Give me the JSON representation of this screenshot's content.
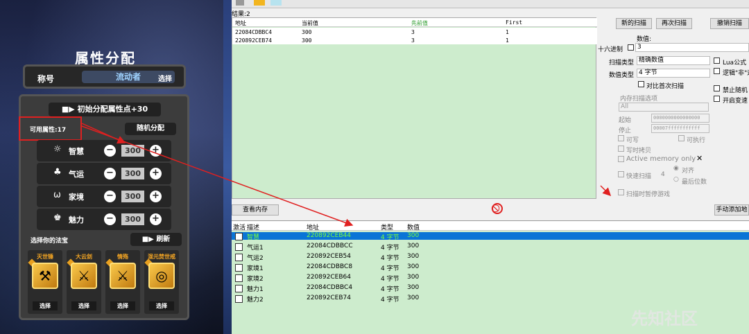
{
  "game": {
    "title": "属性分配",
    "name_label": "称号",
    "name_value": "流动者",
    "name_select": "选择",
    "init_button": "初始分配属性点+30",
    "available": "可用属性:17",
    "random_button": "随机分配",
    "attributes": [
      {
        "icon": "☼",
        "name": "智慧",
        "value": "300"
      },
      {
        "icon": "♣",
        "name": "气运",
        "value": "300"
      },
      {
        "icon": "ω",
        "name": "家境",
        "value": "300"
      },
      {
        "icon": "♚",
        "name": "魅力",
        "value": "300"
      }
    ],
    "treasure_label": "选择你的法宝",
    "refresh_button": "刷新",
    "treasures": [
      {
        "name": "灭世锤",
        "icon": "⚒",
        "pick": "选择"
      },
      {
        "name": "大云剑",
        "icon": "⚔",
        "pick": "选择"
      },
      {
        "name": "情殇",
        "icon": "⚔",
        "pick": "选择"
      },
      {
        "name": "混元焚世戒",
        "icon": "◎",
        "pick": "选择"
      }
    ]
  },
  "ce": {
    "results_label": "结果:2",
    "scan_headers": {
      "addr": "地址",
      "current": "当前值",
      "previous": "先前值",
      "first": "First"
    },
    "scan_rows": [
      {
        "addr": "22084CDBBC4",
        "current": "300",
        "previous": "3",
        "first": "1"
      },
      {
        "addr": "220892CEB74",
        "current": "300",
        "previous": "3",
        "first": "1"
      }
    ],
    "new_scan": "新的扫描",
    "next_scan": "再次扫描",
    "undo_scan": "撤销扫描",
    "value_label": "数值:",
    "hex_label": "十六进制",
    "value_input": "3",
    "scan_type_label": "扫描类型",
    "scan_type_value": "精确数值",
    "value_type_label": "数值类型",
    "value_type_value": "4 字节",
    "compare_first": "对比首次扫描",
    "lua_formula": "Lua公式",
    "logic_not": "逻辑\"非\"运",
    "disable_random": "禁止随机",
    "enable_speed": "开启变速",
    "mem_options": "内存扫描选项",
    "mem_all": "All",
    "start_label": "起始",
    "start_value": "0000000000000000",
    "stop_label": "停止",
    "stop_value": "00007fffffffffff",
    "writable": "可写",
    "executable": "可执行",
    "copy_on_write": "写时拷贝",
    "active_memory": "Active memory only",
    "fast_scan": "快速扫描",
    "fast_value": "4",
    "align": "对齐",
    "last_digits": "最后位数",
    "pause_game": "扫描时暂停游戏",
    "view_memory": "查看内存",
    "manual_add": "手动添加地",
    "addr_headers": {
      "active": "激活",
      "desc": "描述",
      "addr": "地址",
      "type": "类型",
      "value": "数值"
    },
    "addr_rows": [
      {
        "desc": "智慧",
        "addr": "220892CEB44",
        "type": "4 字节",
        "value": "300"
      },
      {
        "desc": "气运1",
        "addr": "22084CDBBCC",
        "type": "4 字节",
        "value": "300"
      },
      {
        "desc": "气运2",
        "addr": "220892CEB54",
        "type": "4 字节",
        "value": "300"
      },
      {
        "desc": "家境1",
        "addr": "22084CDBBC8",
        "type": "4 字节",
        "value": "300"
      },
      {
        "desc": "家境2",
        "addr": "220892CEB64",
        "type": "4 字节",
        "value": "300"
      },
      {
        "desc": "魅力1",
        "addr": "22084CDBBC4",
        "type": "4 字节",
        "value": "300"
      },
      {
        "desc": "魅力2",
        "addr": "220892CEB74",
        "type": "4 字节",
        "value": "300"
      }
    ],
    "watermark": "先知社区"
  },
  "colors": {
    "annotation_red": "#e02020",
    "selected_row": "#0a74d6",
    "list_green": "#cdeccd"
  }
}
